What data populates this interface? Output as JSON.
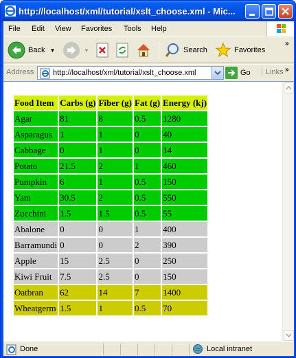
{
  "window": {
    "title": "http://localhost/xml/tutorial/xslt_choose.xml - Mic..."
  },
  "menu": [
    "File",
    "Edit",
    "View",
    "Favorites",
    "Tools",
    "Help"
  ],
  "toolbar": {
    "back_label": "Back",
    "search_label": "Search",
    "favorites_label": "Favorites"
  },
  "address": {
    "label": "Address",
    "url": "http://localhost/xml/tutorial/xslt_choose.xml",
    "go_label": "Go",
    "links_label": "Links"
  },
  "table": {
    "headers": [
      "Food Item",
      "Carbs (g)",
      "Fiber (g)",
      "Fat (g)",
      "Energy (kj)"
    ],
    "header_color": "#d5f00a",
    "rows": [
      {
        "cells": [
          "Agar",
          "81",
          "8",
          "0.5",
          "1280"
        ],
        "color": "green"
      },
      {
        "cells": [
          "Asparagus",
          "1",
          "1",
          "0",
          "40"
        ],
        "color": "green"
      },
      {
        "cells": [
          "Cabbage",
          "0",
          "1",
          "0",
          "14"
        ],
        "color": "green"
      },
      {
        "cells": [
          "Potato",
          "21.5",
          "2",
          "1",
          "460"
        ],
        "color": "green"
      },
      {
        "cells": [
          "Pumpkin",
          "6",
          "1",
          "0.5",
          "150"
        ],
        "color": "green"
      },
      {
        "cells": [
          "Yam",
          "30.5",
          "2",
          "0.5",
          "550"
        ],
        "color": "green"
      },
      {
        "cells": [
          "Zucchini",
          "1.5",
          "1.5",
          "0.5",
          "55"
        ],
        "color": "green"
      },
      {
        "cells": [
          "Abalone",
          "0",
          "0",
          "1",
          "400"
        ],
        "color": "grey"
      },
      {
        "cells": [
          "Barramundi",
          "0",
          "0",
          "2",
          "390"
        ],
        "color": "grey"
      },
      {
        "cells": [
          "Apple",
          "15",
          "2.5",
          "0",
          "250"
        ],
        "color": "grey"
      },
      {
        "cells": [
          "Kiwi Fruit",
          "7.5",
          "2.5",
          "0",
          "150"
        ],
        "color": "grey"
      },
      {
        "cells": [
          "Oatbran",
          "62",
          "14",
          "7",
          "1400"
        ],
        "color": "yellow"
      },
      {
        "cells": [
          "Wheatgerm",
          "1.5",
          "1",
          "0.5",
          "70"
        ],
        "color": "yellow"
      }
    ]
  },
  "status": {
    "left": "Done",
    "zone": "Local intranet"
  },
  "colors": {
    "green": "#00cc00",
    "grey": "#cccccc",
    "yellow": "#cccc00",
    "titlebar": "#0055e5"
  }
}
